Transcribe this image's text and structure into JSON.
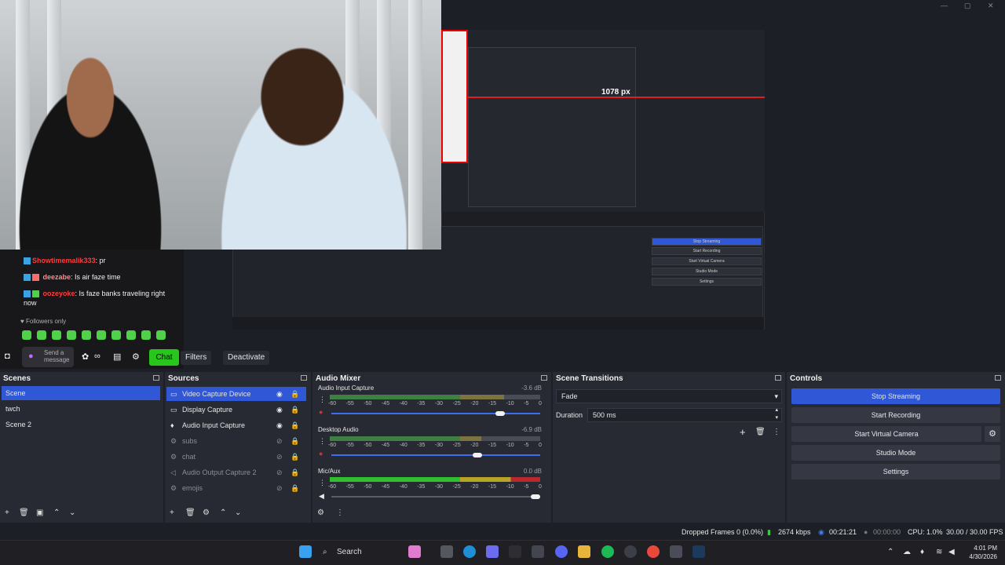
{
  "preview": {
    "canvas_label": "1078 px",
    "nested_buttons": [
      "Stop Streaming",
      "Start Recording",
      "Start Virtual Camera",
      "Studio Mode",
      "Settings"
    ]
  },
  "chat": {
    "messages": [
      {
        "user": "Showtimemalik333",
        "text": ": pr"
      },
      {
        "user": "deezabe",
        "text": ": Is air faze time"
      },
      {
        "user": "oozeyoke",
        "text": ": Is faze banks traveling right now"
      }
    ],
    "followers_label": "Followers only",
    "input_placeholder": "Send a message",
    "chat_button": "Chat"
  },
  "toolbar": {
    "filters_label": "Filters",
    "deactivate_label": "Deactivate"
  },
  "scenes": {
    "title": "Scenes",
    "items": [
      "Scene",
      "twch",
      "Scene 2"
    ],
    "selected": "Scene"
  },
  "sources": {
    "title": "Sources",
    "items": [
      {
        "label": "Video Capture Device",
        "icon": "camera-icon",
        "visible": true
      },
      {
        "label": "Display Capture",
        "icon": "monitor-icon",
        "visible": true
      },
      {
        "label": "Audio Input Capture",
        "icon": "microphone-icon",
        "visible": true
      },
      {
        "label": "subs",
        "icon": "gear-icon",
        "visible": false
      },
      {
        "label": "chat",
        "icon": "gear-icon",
        "visible": false
      },
      {
        "label": "Audio Output Capture 2",
        "icon": "speaker-icon",
        "visible": false
      },
      {
        "label": "emojis",
        "icon": "gear-icon",
        "visible": false
      }
    ]
  },
  "mixer": {
    "title": "Audio Mixer",
    "channels": [
      {
        "name": "Audio Input Capture",
        "db": "-3.6 dB",
        "level": 0.83
      },
      {
        "name": "Desktop Audio",
        "db": "-6.9 dB",
        "level": 0.72
      },
      {
        "name": "Mic/Aux",
        "db": "0.0 dB",
        "level": 1.0
      }
    ],
    "scale": [
      "-60",
      "-55",
      "-50",
      "-45",
      "-40",
      "-35",
      "-30",
      "-25",
      "-20",
      "-15",
      "-10",
      "-5",
      "0"
    ]
  },
  "transitions": {
    "title": "Scene Transitions",
    "type": "Fade",
    "duration_label": "Duration",
    "duration_value": "500 ms"
  },
  "controls": {
    "title": "Controls",
    "stop_streaming": "Stop Streaming",
    "start_recording": "Start Recording",
    "start_virtual_camera": "Start Virtual Camera",
    "studio_mode": "Studio Mode",
    "settings": "Settings"
  },
  "status": {
    "dropped_frames": "Dropped Frames 0 (0.0%)",
    "bitrate": "2674 kbps",
    "stream_time": "00:21:21",
    "rec_time": "00:00:00",
    "cpu": "CPU: 1.0%",
    "fps": "30.00 / 30.00 FPS"
  },
  "taskbar": {
    "search_label": "Search",
    "time": "4:01 PM",
    "date": "4/30/2026"
  },
  "colors": {
    "accent": "#2f57d6",
    "chat_button": "#27c61a",
    "meter_green": "#2fbf2f",
    "meter_yellow": "#b7a326",
    "meter_red": "#b8282e"
  }
}
